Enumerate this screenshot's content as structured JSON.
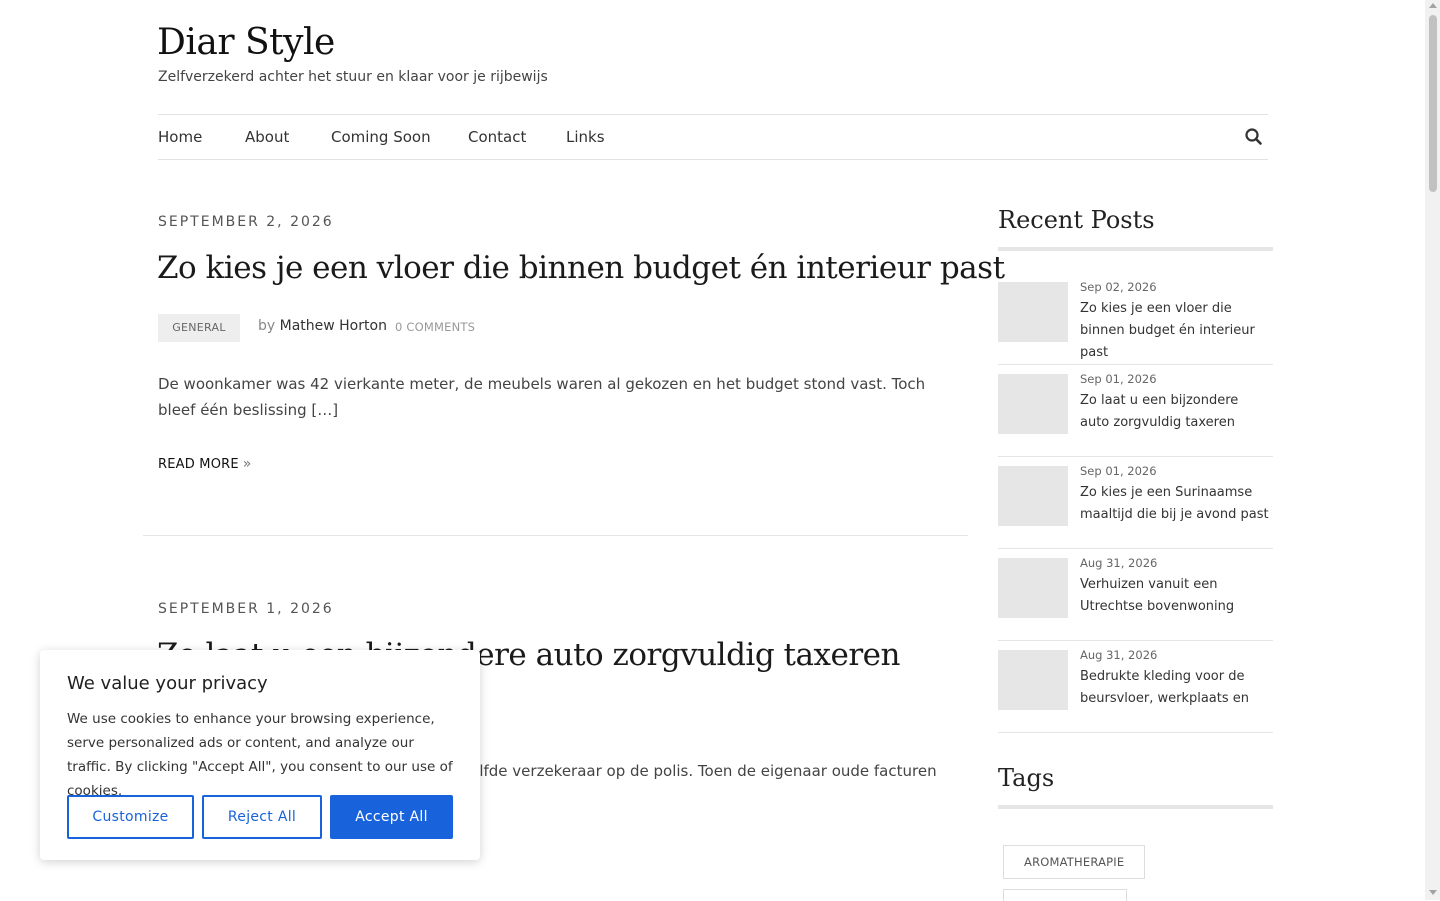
{
  "site": {
    "title": "Diar Style",
    "tagline": "Zelfverzekerd achter het stuur en klaar voor je rijbewijs"
  },
  "nav": {
    "items": [
      "Home",
      "About",
      "Coming Soon",
      "Contact",
      "Links"
    ],
    "search_icon": "search-icon"
  },
  "posts": [
    {
      "date": "SEPTEMBER 2, 2026",
      "title": "Zo kies je een vloer die binnen budget én interieur past",
      "category": "GENERAL",
      "by": "by",
      "author": "Mathew Horton",
      "comments": "0 COMMENTS",
      "excerpt": "De woonkamer was 42 vierkante meter, de meubels waren al gekozen en het budget stond vast. Toch bleef één beslissing […]",
      "read_more": "READ MORE"
    },
    {
      "date": "SEPTEMBER 1, 2026",
      "title": "Zo laat u een bijzondere auto zorgvuldig taxeren",
      "excerpt_visible": "ezelfde verzekeraar op de polis. Toen de eigenaar oude facturen"
    }
  ],
  "sidebar": {
    "recent_title": "Recent Posts",
    "recent": [
      {
        "date": "Sep 02, 2026",
        "title": "Zo kies je een vloer die binnen budget én interieur past"
      },
      {
        "date": "Sep 01, 2026",
        "title": "Zo laat u een bijzondere auto zorgvuldig taxeren"
      },
      {
        "date": "Sep 01, 2026",
        "title": "Zo kies je een Surinaamse maaltijd die bij je avond past"
      },
      {
        "date": "Aug 31, 2026",
        "title": "Verhuizen vanuit een Utrechtse bovenwoning"
      },
      {
        "date": "Aug 31, 2026",
        "title": "Bedrukte kleding voor de beursvloer, werkplaats en"
      }
    ],
    "tags_title": "Tags",
    "tags": [
      "AROMATHERAPIE"
    ]
  },
  "cookie": {
    "title": "We value your privacy",
    "text": "We use cookies to enhance your browsing experience, serve personalized ads or content, and analyze our traffic. By clicking \"Accept All\", you consent to our use of cookies.",
    "customize": "Customize",
    "reject": "Reject All",
    "accept": "Accept All",
    "accent_color": "#1863dc"
  }
}
